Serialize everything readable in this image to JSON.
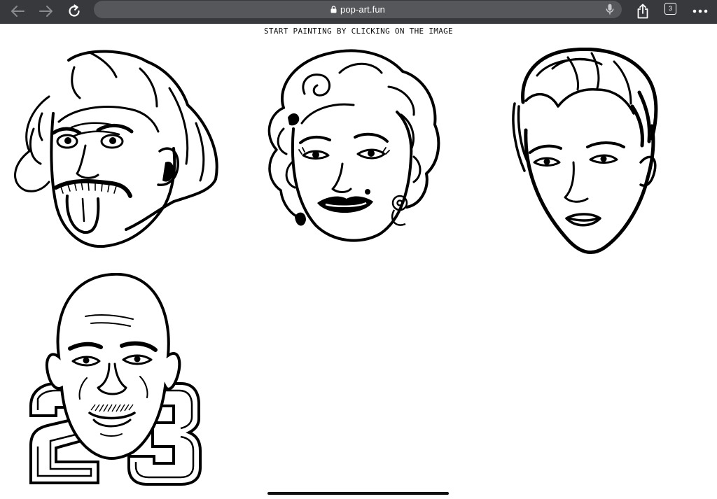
{
  "browser": {
    "url": "pop-art.fun",
    "tab_count": "3",
    "icons": {
      "back": "back-arrow-icon",
      "forward": "forward-arrow-icon",
      "reload": "reload-icon",
      "lock": "lock-icon",
      "microphone": "microphone-icon",
      "share": "share-icon",
      "tabs": "tabs-icon",
      "more": "more-icon"
    },
    "colors": {
      "toolbar": "#38393d",
      "address_bar": "#56575b",
      "icon_active": "#ffffff",
      "icon_disabled": "#8a8b8f"
    }
  },
  "page": {
    "heading": "START PAINTING BY CLICKING ON THE IMAGE",
    "images": [
      {
        "id": "einstein"
      },
      {
        "id": "marilyn"
      },
      {
        "id": "elvis"
      },
      {
        "id": "jordan"
      }
    ]
  }
}
